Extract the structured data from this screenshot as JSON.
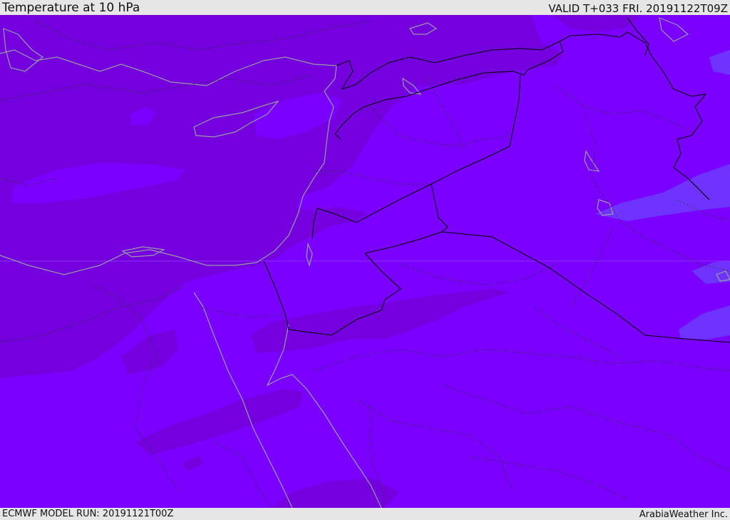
{
  "header": {
    "title": "Temperature at 10 hPa",
    "valid": "VALID T+033 FRI. 20191122T09Z"
  },
  "footer": {
    "model_run": "ECMWF MODEL RUN: 20191121T00Z",
    "credit": "ArabiaWeather Inc."
  },
  "colors": {
    "base_field": "#7a00ff",
    "cold_field": "#7400dd",
    "warm_field": "#6e33ff",
    "coastline": "#9a9aa8",
    "border_major": "#000000",
    "border_minor": "#333344",
    "bars": "#e6e6e6"
  }
}
